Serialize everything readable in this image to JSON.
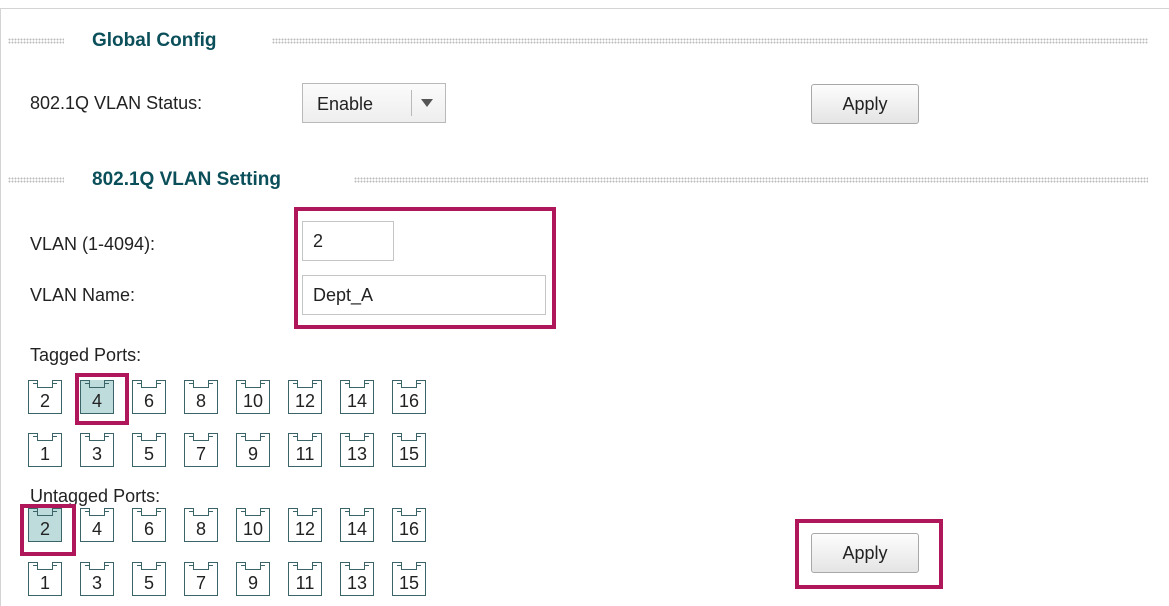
{
  "global": {
    "title": "Global Config",
    "status_label": "802.1Q VLAN Status:",
    "status_value": "Enable",
    "apply_label": "Apply"
  },
  "setting": {
    "title": "802.1Q VLAN Setting",
    "vlan_id_label": "VLAN (1-4094):",
    "vlan_id_value": "2",
    "vlan_name_label": "VLAN Name:",
    "vlan_name_value": "Dept_A",
    "tagged_label": "Tagged Ports:",
    "untagged_label": "Untagged Ports:",
    "apply_label": "Apply"
  },
  "tagged": {
    "row_even": [
      "2",
      "4",
      "6",
      "8",
      "10",
      "12",
      "14",
      "16"
    ],
    "row_odd": [
      "1",
      "3",
      "5",
      "7",
      "9",
      "11",
      "13",
      "15"
    ],
    "selected": [
      "4"
    ]
  },
  "untagged": {
    "row_even": [
      "2",
      "4",
      "6",
      "8",
      "10",
      "12",
      "14",
      "16"
    ],
    "row_odd": [
      "1",
      "3",
      "5",
      "7",
      "9",
      "11",
      "13",
      "15"
    ],
    "selected": [
      "2"
    ]
  },
  "colors": {
    "highlight": "#b0175b",
    "section_title": "#0b4f5a",
    "selected_port": "#bfdcdc"
  }
}
